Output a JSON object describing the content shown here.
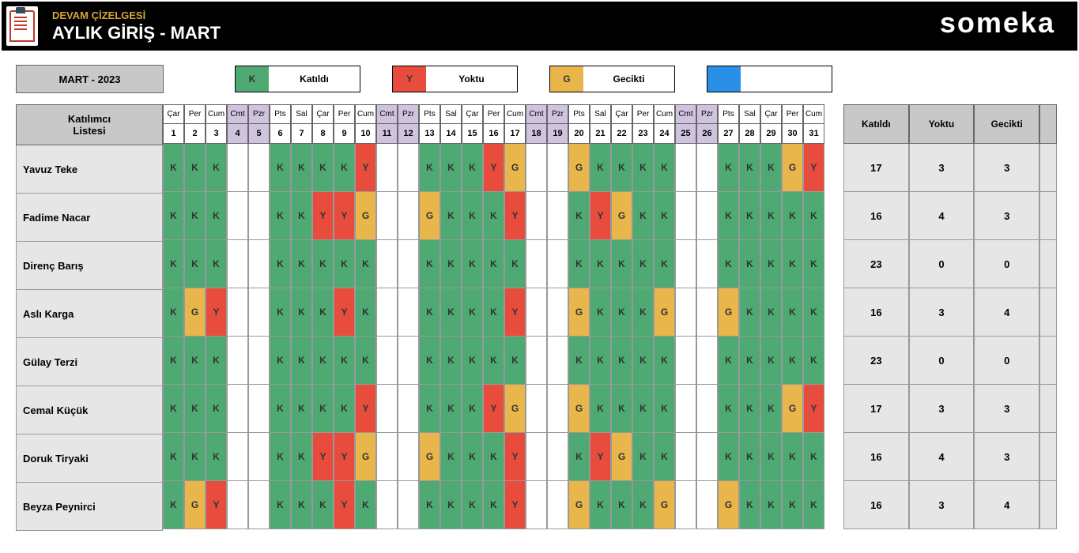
{
  "header": {
    "small_title": "DEVAM ÇİZELGESİ",
    "main_title": "AYLIK GİRİŞ - MART",
    "brand": "someka"
  },
  "month_box": "MART - 2023",
  "legend": {
    "K": {
      "code": "K",
      "label": "Katıldı",
      "color": "#4ea972"
    },
    "Y": {
      "code": "Y",
      "label": "Yoktu",
      "color": "#e74c3c"
    },
    "G": {
      "code": "G",
      "label": "Gecikti",
      "color": "#e8b64b"
    },
    "B": {
      "code": "",
      "label": "",
      "color": "#2a8fe6"
    }
  },
  "participant_header": {
    "line1": "Katılımcı",
    "line2": "Listesi"
  },
  "days": [
    {
      "dow": "Çar",
      "num": "1",
      "weekend": false
    },
    {
      "dow": "Per",
      "num": "2",
      "weekend": false
    },
    {
      "dow": "Cum",
      "num": "3",
      "weekend": false
    },
    {
      "dow": "Cmt",
      "num": "4",
      "weekend": true
    },
    {
      "dow": "Pzr",
      "num": "5",
      "weekend": true
    },
    {
      "dow": "Pts",
      "num": "6",
      "weekend": false
    },
    {
      "dow": "Sal",
      "num": "7",
      "weekend": false
    },
    {
      "dow": "Çar",
      "num": "8",
      "weekend": false
    },
    {
      "dow": "Per",
      "num": "9",
      "weekend": false
    },
    {
      "dow": "Cum",
      "num": "10",
      "weekend": false
    },
    {
      "dow": "Cmt",
      "num": "11",
      "weekend": true
    },
    {
      "dow": "Pzr",
      "num": "12",
      "weekend": true
    },
    {
      "dow": "Pts",
      "num": "13",
      "weekend": false
    },
    {
      "dow": "Sal",
      "num": "14",
      "weekend": false
    },
    {
      "dow": "Çar",
      "num": "15",
      "weekend": false
    },
    {
      "dow": "Per",
      "num": "16",
      "weekend": false
    },
    {
      "dow": "Cum",
      "num": "17",
      "weekend": false
    },
    {
      "dow": "Cmt",
      "num": "18",
      "weekend": true
    },
    {
      "dow": "Pzr",
      "num": "19",
      "weekend": true
    },
    {
      "dow": "Pts",
      "num": "20",
      "weekend": false
    },
    {
      "dow": "Sal",
      "num": "21",
      "weekend": false
    },
    {
      "dow": "Çar",
      "num": "22",
      "weekend": false
    },
    {
      "dow": "Per",
      "num": "23",
      "weekend": false
    },
    {
      "dow": "Cum",
      "num": "24",
      "weekend": false
    },
    {
      "dow": "Cmt",
      "num": "25",
      "weekend": true
    },
    {
      "dow": "Pzr",
      "num": "26",
      "weekend": true
    },
    {
      "dow": "Pts",
      "num": "27",
      "weekend": false
    },
    {
      "dow": "Sal",
      "num": "28",
      "weekend": false
    },
    {
      "dow": "Çar",
      "num": "29",
      "weekend": false
    },
    {
      "dow": "Per",
      "num": "30",
      "weekend": false
    },
    {
      "dow": "Cum",
      "num": "31",
      "weekend": false
    }
  ],
  "participants": [
    {
      "name": "Yavuz Teke",
      "cells": [
        "K",
        "K",
        "K",
        "",
        "",
        "K",
        "K",
        "K",
        "K",
        "Y",
        "",
        "",
        "K",
        "K",
        "K",
        "Y",
        "G",
        "",
        "",
        "G",
        "K",
        "K",
        "K",
        "K",
        "",
        "",
        "K",
        "K",
        "K",
        "G",
        "Y"
      ],
      "summary": {
        "K": "17",
        "Y": "3",
        "G": "3"
      }
    },
    {
      "name": "Fadime Nacar",
      "cells": [
        "K",
        "K",
        "K",
        "",
        "",
        "K",
        "K",
        "Y",
        "Y",
        "G",
        "",
        "",
        "G",
        "K",
        "K",
        "K",
        "Y",
        "",
        "",
        "K",
        "Y",
        "G",
        "K",
        "K",
        "",
        "",
        "K",
        "K",
        "K",
        "K",
        "K"
      ],
      "summary": {
        "K": "16",
        "Y": "4",
        "G": "3"
      }
    },
    {
      "name": "Direnç Barış",
      "cells": [
        "K",
        "K",
        "K",
        "",
        "",
        "K",
        "K",
        "K",
        "K",
        "K",
        "",
        "",
        "K",
        "K",
        "K",
        "K",
        "K",
        "",
        "",
        "K",
        "K",
        "K",
        "K",
        "K",
        "",
        "",
        "K",
        "K",
        "K",
        "K",
        "K"
      ],
      "summary": {
        "K": "23",
        "Y": "0",
        "G": "0"
      }
    },
    {
      "name": "Aslı Karga",
      "cells": [
        "K",
        "G",
        "Y",
        "",
        "",
        "K",
        "K",
        "K",
        "Y",
        "K",
        "",
        "",
        "K",
        "K",
        "K",
        "K",
        "Y",
        "",
        "",
        "G",
        "K",
        "K",
        "K",
        "G",
        "",
        "",
        "G",
        "K",
        "K",
        "K",
        "K"
      ],
      "summary": {
        "K": "16",
        "Y": "3",
        "G": "4"
      }
    },
    {
      "name": "Gülay Terzi",
      "cells": [
        "K",
        "K",
        "K",
        "",
        "",
        "K",
        "K",
        "K",
        "K",
        "K",
        "",
        "",
        "K",
        "K",
        "K",
        "K",
        "K",
        "",
        "",
        "K",
        "K",
        "K",
        "K",
        "K",
        "",
        "",
        "K",
        "K",
        "K",
        "K",
        "K"
      ],
      "summary": {
        "K": "23",
        "Y": "0",
        "G": "0"
      }
    },
    {
      "name": "Cemal Küçük",
      "cells": [
        "K",
        "K",
        "K",
        "",
        "",
        "K",
        "K",
        "K",
        "K",
        "Y",
        "",
        "",
        "K",
        "K",
        "K",
        "Y",
        "G",
        "",
        "",
        "G",
        "K",
        "K",
        "K",
        "K",
        "",
        "",
        "K",
        "K",
        "K",
        "G",
        "Y"
      ],
      "summary": {
        "K": "17",
        "Y": "3",
        "G": "3"
      }
    },
    {
      "name": "Doruk Tiryaki",
      "cells": [
        "K",
        "K",
        "K",
        "",
        "",
        "K",
        "K",
        "Y",
        "Y",
        "G",
        "",
        "",
        "G",
        "K",
        "K",
        "K",
        "Y",
        "",
        "",
        "K",
        "Y",
        "G",
        "K",
        "K",
        "",
        "",
        "K",
        "K",
        "K",
        "K",
        "K"
      ],
      "summary": {
        "K": "16",
        "Y": "4",
        "G": "3"
      }
    },
    {
      "name": "Beyza Peynirci",
      "cells": [
        "K",
        "G",
        "Y",
        "",
        "",
        "K",
        "K",
        "K",
        "Y",
        "K",
        "",
        "",
        "K",
        "K",
        "K",
        "K",
        "Y",
        "",
        "",
        "G",
        "K",
        "K",
        "K",
        "G",
        "",
        "",
        "G",
        "K",
        "K",
        "K",
        "K"
      ],
      "summary": {
        "K": "16",
        "Y": "3",
        "G": "4"
      }
    }
  ],
  "summary_headers": {
    "K": "Katıldı",
    "Y": "Yoktu",
    "G": "Gecikti",
    "blank": ""
  }
}
